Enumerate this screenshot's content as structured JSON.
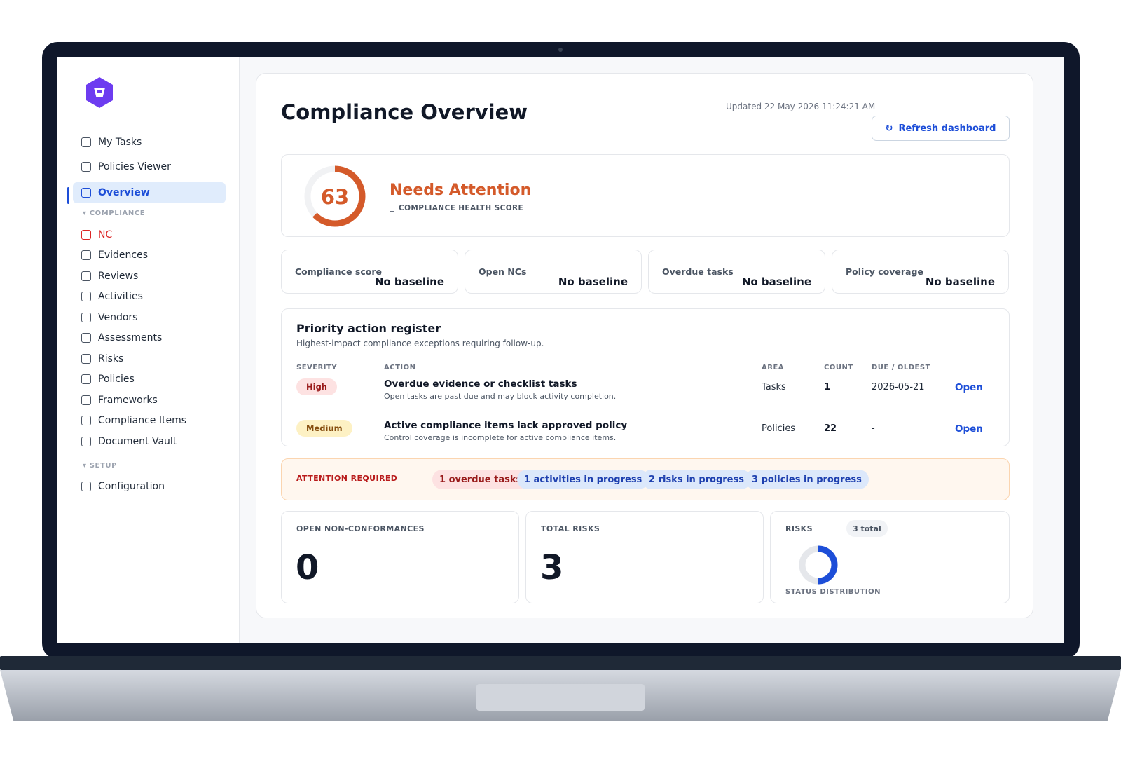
{
  "sidebar": {
    "items_top": [
      {
        "label": "My Tasks",
        "icon": "checkbox-icon"
      },
      {
        "label": "Policies Viewer",
        "icon": "checkbox-icon"
      },
      {
        "label": "Overview",
        "icon": "checkbox-icon",
        "active": true
      }
    ],
    "section_compliance": "COMPLIANCE",
    "items_compliance": [
      {
        "label": "NC"
      },
      {
        "label": "Evidences"
      },
      {
        "label": "Reviews"
      },
      {
        "label": "Activities"
      },
      {
        "label": "Vendors"
      },
      {
        "label": "Assessments"
      },
      {
        "label": "Risks"
      },
      {
        "label": "Policies"
      },
      {
        "label": "Frameworks"
      },
      {
        "label": "Compliance Items"
      },
      {
        "label": "Document Vault"
      }
    ],
    "section_setup": "SETUP",
    "items_setup": [
      {
        "label": "Configuration"
      }
    ],
    "collapse_glyph": "▾"
  },
  "header": {
    "title": "Compliance Overview",
    "updated": "Updated 22 May 2026 11:24:21 AM",
    "refresh_glyph": "↻",
    "refresh_label": "Refresh dashboard"
  },
  "health": {
    "score": "63",
    "score_fraction": 0.63,
    "status": "Needs Attention",
    "subtitle": "COMPLIANCE HEALTH SCORE",
    "ring_color": "#d45a2a"
  },
  "kpis": [
    {
      "label": "Compliance score",
      "value": "No baseline"
    },
    {
      "label": "Open NCs",
      "value": "No baseline"
    },
    {
      "label": "Overdue tasks",
      "value": "No baseline"
    },
    {
      "label": "Policy coverage",
      "value": "No baseline"
    }
  ],
  "register": {
    "title": "Priority action register",
    "subtitle": "Highest-impact compliance exceptions requiring follow-up.",
    "columns": {
      "severity": "SEVERITY",
      "action": "ACTION",
      "area": "AREA",
      "count": "COUNT",
      "due": "DUE / OLDEST"
    },
    "rows": [
      {
        "severity": "High",
        "title": "Overdue evidence or checklist tasks",
        "desc": "Open tasks are past due and may block activity completion.",
        "area": "Tasks",
        "count": "1",
        "due": "2026-05-21",
        "link": "Open"
      },
      {
        "severity": "Medium",
        "title": "Active compliance items lack approved policy",
        "desc": "Control coverage is incomplete for active compliance items.",
        "area": "Policies",
        "count": "22",
        "due": "-",
        "link": "Open"
      }
    ]
  },
  "attention": {
    "label": "ATTENTION REQUIRED",
    "pills": [
      {
        "text": "1 overdue tasks",
        "tone": "red"
      },
      {
        "text": "1 activities in progress",
        "tone": "blue"
      },
      {
        "text": "2 risks in progress",
        "tone": "blue"
      },
      {
        "text": "3 policies in progress",
        "tone": "blue"
      }
    ]
  },
  "stats": {
    "open_nc_label": "OPEN NON-CONFORMANCES",
    "open_nc_value": "0",
    "total_risks_label": "TOTAL RISKS",
    "total_risks_value": "3",
    "risks_label": "RISKS",
    "risks_total_badge": "3 total",
    "risks_dist_label": "STATUS DISTRIBUTION",
    "risks_dist_fraction": 0.5,
    "risks_dist_color": "#1d4ed8"
  }
}
